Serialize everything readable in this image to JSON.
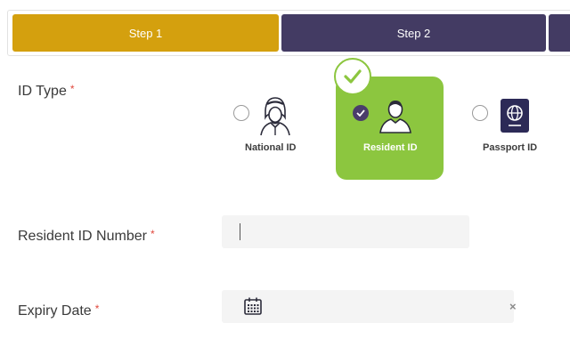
{
  "stepper": {
    "steps": [
      {
        "label": "Step 1"
      },
      {
        "label": "Step 2"
      },
      {
        "label": ""
      }
    ]
  },
  "form": {
    "id_type": {
      "label": "ID Type",
      "required_mark": "*",
      "options": [
        {
          "label": "National ID",
          "icon": "arab-man-icon",
          "selected": false
        },
        {
          "label": "Resident ID",
          "icon": "person-icon",
          "selected": true
        },
        {
          "label": "Passport ID",
          "icon": "passport-icon",
          "selected": false
        }
      ]
    },
    "resident_id_number": {
      "label": "Resident ID Number",
      "required_mark": "*",
      "value": ""
    },
    "expiry_date": {
      "label": "Expiry Date",
      "required_mark": "*",
      "value": "",
      "clear_glyph": "×"
    }
  },
  "colors": {
    "step_active": "#d4a00e",
    "step_inactive": "#433b63",
    "selected_card": "#8cc63f",
    "required": "#e0473c"
  }
}
